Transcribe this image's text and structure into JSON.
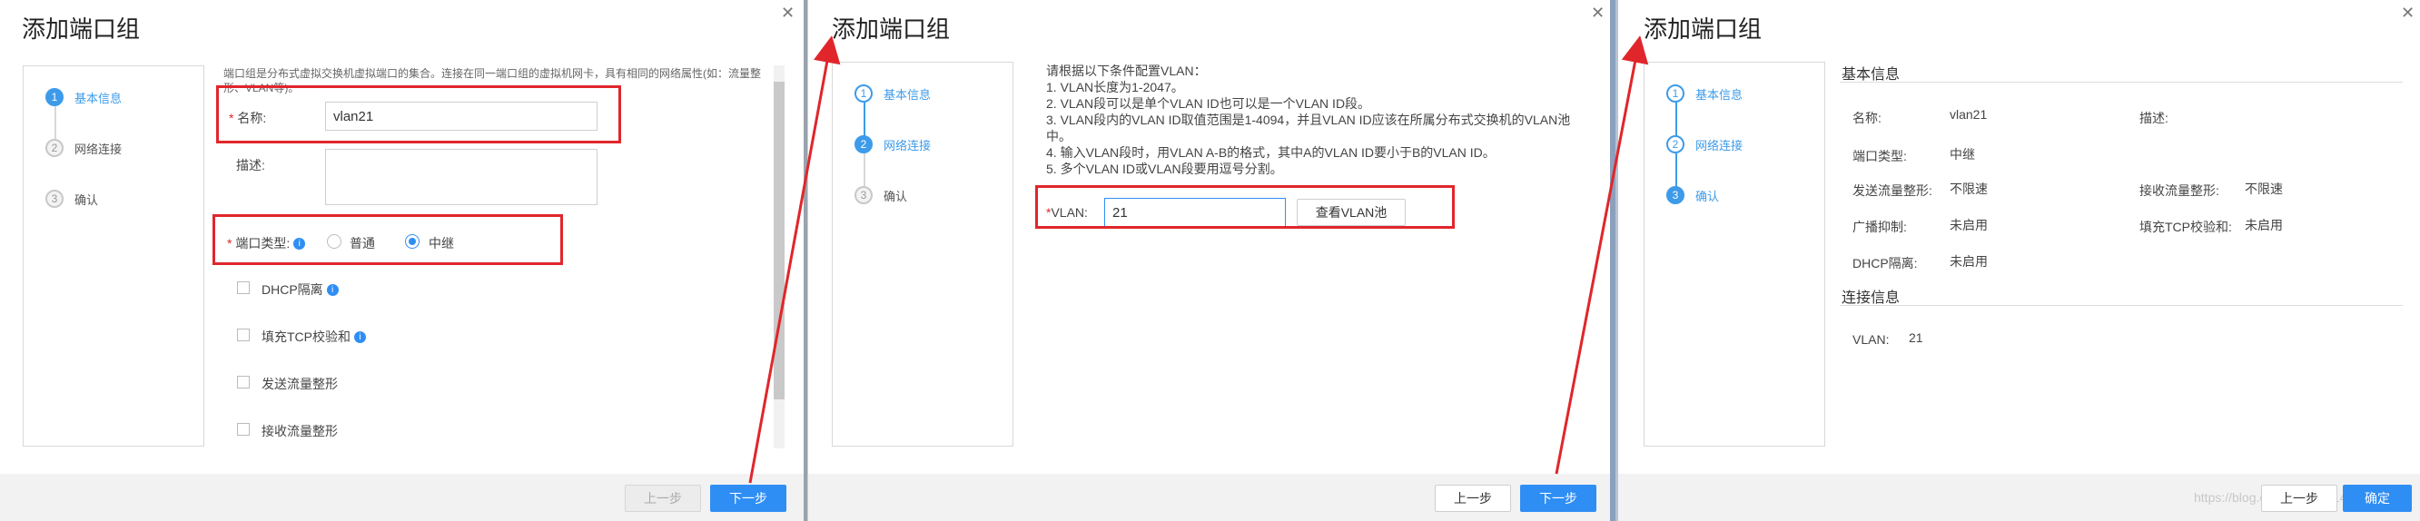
{
  "colors": {
    "accent": "#2f8ef4",
    "highlight_box": "#e0262b",
    "arrow": "#e0262b"
  },
  "panel1": {
    "title": "添加端口组",
    "close_icon": "close-icon",
    "steps": [
      "基本信息",
      "网络连接",
      "确认"
    ],
    "step_numbers": [
      "1",
      "2",
      "3"
    ],
    "description_line1": "端口组是分布式虚拟交换机虚拟端口的集合。连接在同一端口组的虚拟机网卡，具有相同的网络属性(如：流量整",
    "description_line2": "形、VLAN等)。",
    "name_label": "名称:",
    "name_value": "vlan21",
    "desc_label": "描述:",
    "port_type_label": "端口类型:",
    "port_type_options": [
      "普通",
      "中继"
    ],
    "port_type_selected": "中继",
    "checkboxes": [
      "DHCP隔离",
      "填充TCP校验和",
      "发送流量整形",
      "接收流量整形"
    ],
    "buttons": {
      "prev": "上一步",
      "next": "下一步"
    }
  },
  "panel2": {
    "title": "添加端口组",
    "steps": [
      "基本信息",
      "网络连接",
      "确认"
    ],
    "step_numbers": [
      "1",
      "2",
      "3"
    ],
    "instructions": [
      "请根据以下条件配置VLAN：",
      "1. VLAN长度为1-2047。",
      "2. VLAN段可以是单个VLAN ID也可以是一个VLAN ID段。",
      "3. VLAN段内的VLAN ID取值范围是1-4094，并且VLAN ID应该在所属分布式交换机的VLAN池",
      "中。",
      "4. 输入VLAN段时，用VLAN A-B的格式，其中A的VLAN ID要小于B的VLAN ID。",
      "5. 多个VLAN ID或VLAN段要用逗号分割。"
    ],
    "vlan_label": "VLAN:",
    "vlan_value": "21",
    "view_pool_button": "查看VLAN池",
    "buttons": {
      "prev": "上一步",
      "next": "下一步"
    }
  },
  "panel3": {
    "title": "添加端口组",
    "steps": [
      "基本信息",
      "网络连接",
      "确认"
    ],
    "step_numbers": [
      "1",
      "2",
      "3"
    ],
    "basic_info_title": "基本信息",
    "fields_left": [
      {
        "label": "名称:",
        "value": "vlan21"
      },
      {
        "label": "端口类型:",
        "value": "中继"
      },
      {
        "label": "发送流量整形:",
        "value": "不限速"
      },
      {
        "label": "广播抑制:",
        "value": "未启用"
      },
      {
        "label": "DHCP隔离:",
        "value": "未启用"
      }
    ],
    "fields_right": [
      {
        "label": "描述:",
        "value": ""
      },
      {
        "label": "接收流量整形:",
        "value": "不限速"
      },
      {
        "label": "填充TCP校验和:",
        "value": "未启用"
      }
    ],
    "connection_title": "连接信息",
    "vlan_label": "VLAN:",
    "vlan_value": "21",
    "buttons": {
      "prev": "上一步",
      "finish": "确定"
    },
    "watermark": "https://blog.csdn.net/qq_14043"
  }
}
